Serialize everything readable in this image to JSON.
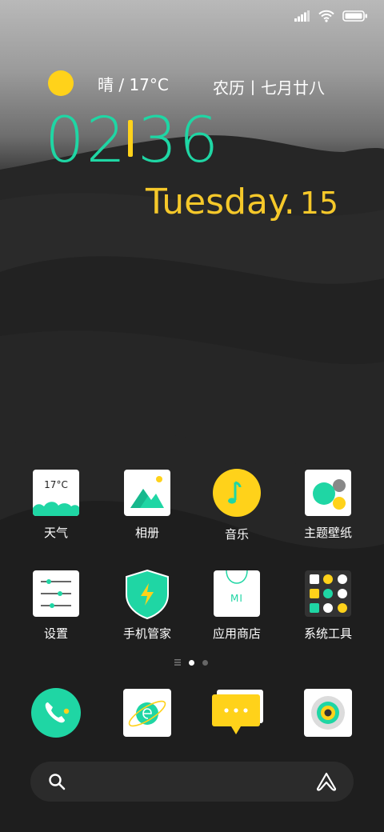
{
  "weather": {
    "text": "晴 / 17°C",
    "sun_color": "#ffd21a"
  },
  "lunar_date": "农历丨七月廿八",
  "clock": {
    "hours": "02",
    "minutes": "36",
    "day": "Tuesday.",
    "date_num": "15",
    "time_color": "#1fd6a4",
    "day_color": "#f5c82a"
  },
  "apps_row1": [
    {
      "label": "天气",
      "tile_text": "17°C"
    },
    {
      "label": "相册"
    },
    {
      "label": "音乐"
    },
    {
      "label": "主题壁纸"
    }
  ],
  "apps_row2": [
    {
      "label": "设置"
    },
    {
      "label": "手机管家"
    },
    {
      "label": "应用商店",
      "tile_text": "MI"
    },
    {
      "label": "系统工具"
    }
  ],
  "dock": [
    "phone-icon",
    "browser-icon",
    "messages-icon",
    "camera-icon"
  ],
  "page_indicator": {
    "pages": 2,
    "active": 1
  },
  "accent": "#1fd6a4"
}
